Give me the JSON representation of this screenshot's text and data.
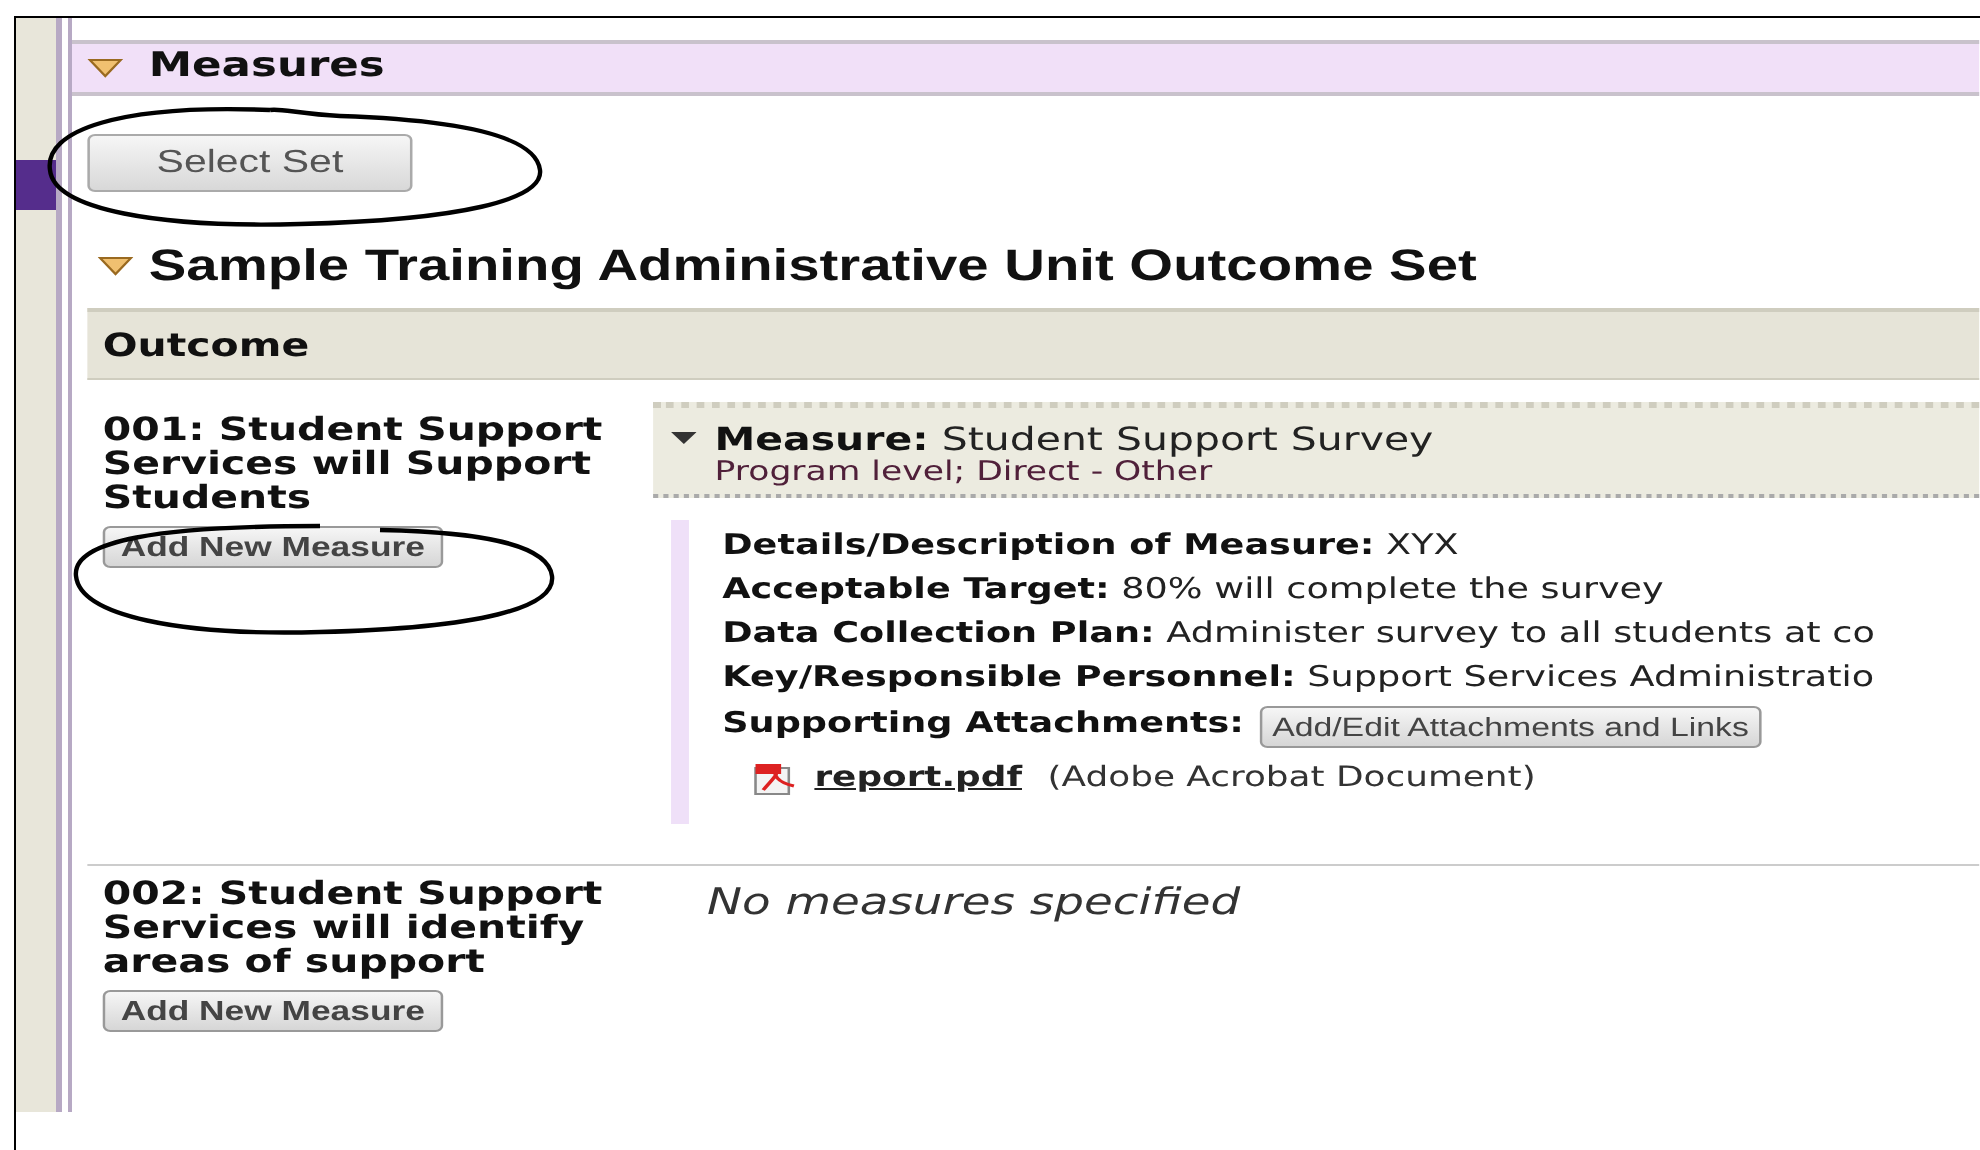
{
  "section": {
    "title": "Measures",
    "expanded": true
  },
  "select_set_button": "Select Set",
  "outcome_set": {
    "title": "Sample Training Administrative Unit Outcome Set",
    "expanded": true
  },
  "table": {
    "columns": [
      "Outcome"
    ],
    "rows": [
      {
        "outcome": "001: Student Support Services will Support Students",
        "add_button": "Add New Measure",
        "measures": [
          {
            "label": "Measure:",
            "name": "Student Support Survey",
            "subtitle": "Program level; Direct - Other",
            "expanded": true,
            "details": [
              {
                "label": "Details/Description of Measure:",
                "value": "XYX"
              },
              {
                "label": "Acceptable Target:",
                "value": "80% will complete the survey"
              },
              {
                "label": "Data Collection Plan:",
                "value": "Administer survey to all students at co"
              },
              {
                "label": "Key/Responsible Personnel:",
                "value": "Support Services Administratio"
              }
            ],
            "attachments": {
              "label": "Supporting Attachments:",
              "button": "Add/Edit Attachments and Links",
              "files": [
                {
                  "name": "report.pdf",
                  "type": "(Adobe Acrobat Document)"
                }
              ]
            }
          }
        ]
      },
      {
        "outcome": "002: Student Support Services will identify areas of support",
        "add_button": "Add New Measure",
        "empty_text": "No measures specified"
      }
    ]
  }
}
